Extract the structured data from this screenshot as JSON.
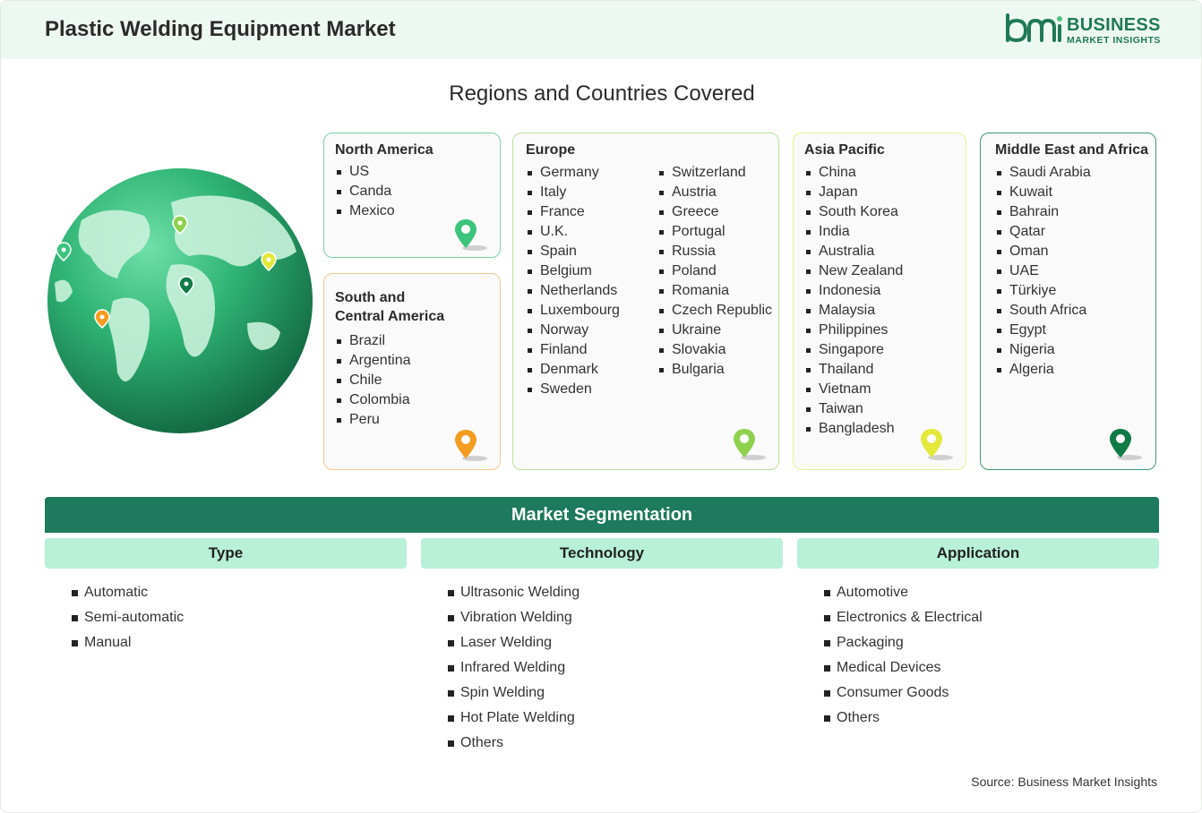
{
  "header": {
    "title": "Plastic Welding Equipment Market",
    "logo_line1": "BUSINESS",
    "logo_line2": "MARKET INSIGHTS",
    "logo_mark": "bmi"
  },
  "regions_section": {
    "title": "Regions and Countries Covered",
    "regions": {
      "north_america": {
        "name": "North America",
        "countries": [
          "US",
          "Canda",
          "Mexico"
        ],
        "pin_color": "#3cc47c",
        "border": "#7fd3a6"
      },
      "south_central_america": {
        "name_line1": "South and",
        "name_line2": "Central America",
        "countries": [
          "Brazil",
          "Argentina",
          "Chile",
          "Colombia",
          "Peru"
        ],
        "pin_color": "#f39c1f",
        "border": "#f5c98a"
      },
      "europe": {
        "name": "Europe",
        "countries_col1": [
          "Germany",
          "Italy",
          "France",
          "U.K.",
          "Spain",
          "Belgium",
          "Netherlands",
          "Luxembourg",
          "Norway",
          "Finland",
          "Denmark",
          "Sweden"
        ],
        "countries_col2": [
          "Switzerland",
          "Austria",
          "Greece",
          "Portugal",
          "Russia",
          "Poland",
          "Romania",
          "Czech Republic",
          "Ukraine",
          "Slovakia",
          "Bulgaria"
        ],
        "pin_color": "#8fd14f",
        "border": "#b9e39a"
      },
      "asia_pacific": {
        "name": "Asia Pacific",
        "countries": [
          "China",
          "Japan",
          "South Korea",
          "India",
          "Australia",
          "New Zealand",
          "Indonesia",
          "Malaysia",
          "Philippines",
          "Singapore",
          "Thailand",
          "Vietnam",
          "Taiwan",
          "Bangladesh"
        ],
        "pin_color": "#e3e83a",
        "border": "#ecef8c"
      },
      "middle_east_africa": {
        "name": "Middle East and Africa",
        "countries": [
          "Saudi Arabia",
          "Kuwait",
          "Bahrain",
          "Qatar",
          "Oman",
          "UAE",
          "Türkiye",
          "South Africa",
          "Egypt",
          "Nigeria",
          "Algeria"
        ],
        "pin_color": "#0f7a45",
        "border": "#3f9a6d"
      }
    }
  },
  "segmentation": {
    "title": "Market Segmentation",
    "type": {
      "label": "Type",
      "items": [
        "Automatic",
        "Semi-automatic",
        "Manual"
      ]
    },
    "technology": {
      "label": "Technology",
      "items": [
        "Ultrasonic Welding",
        "Vibration Welding",
        "Laser Welding",
        "Infrared Welding",
        "Spin Welding",
        "Hot Plate Welding",
        "Others"
      ]
    },
    "application": {
      "label": "Application",
      "items": [
        "Automotive",
        "Electronics & Electrical",
        "Packaging",
        "Medical Devices",
        "Consumer Goods",
        "Others"
      ]
    }
  },
  "source": "Source: Business Market Insights",
  "colors": {
    "brand": "#1f7a55",
    "segment_bar": "#1d7a5c",
    "segment_head": "#b8f0d8",
    "header_bg": "#eef8f2"
  }
}
